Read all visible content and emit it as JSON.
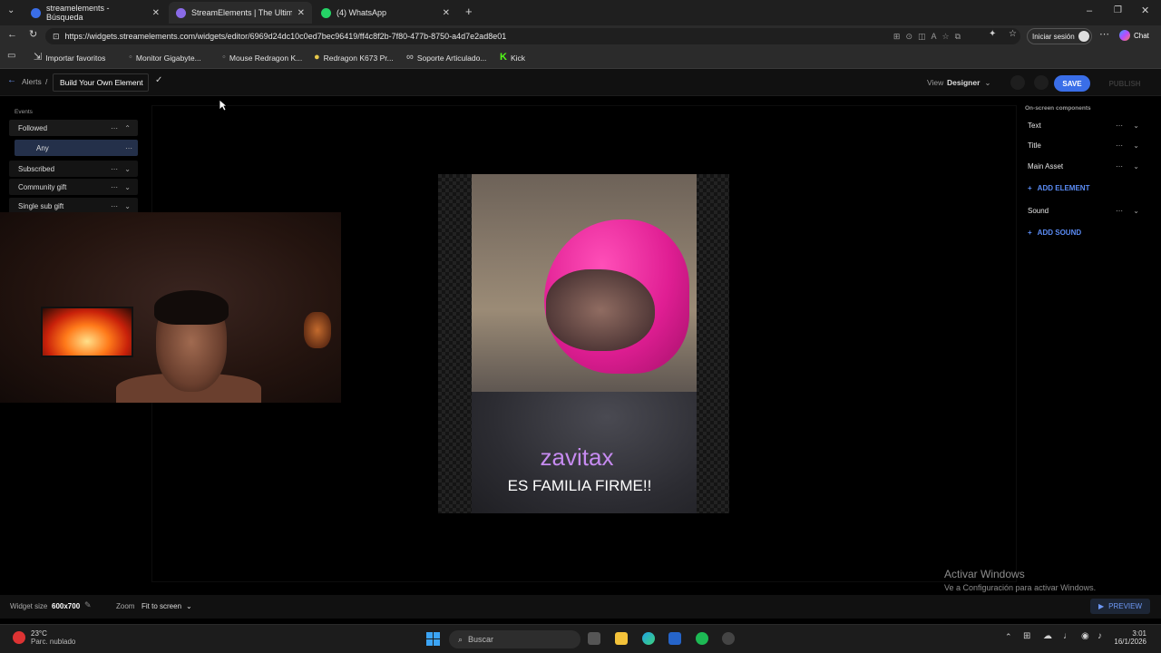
{
  "browser": {
    "tabs": [
      {
        "title": "streamelements - Búsqueda",
        "favicon_color": "#3a6ee8"
      },
      {
        "title": "StreamElements | The Ultimate St",
        "favicon_color": "#8a6be8"
      },
      {
        "title": "(4) WhatsApp",
        "favicon_color": "#25d366"
      }
    ],
    "url": "https://widgets.streamelements.com/widgets/editor/6969d24dc10c0ed7bec96419/ff4c8f2b-7f80-477b-8750-a4d7e2ad8e01",
    "signin_label": "Iniciar sesión",
    "chat_label": "Chat",
    "bookmarks": [
      "Importar favoritos",
      "Monitor Gigabyte...",
      "Mouse Redragon K...",
      "Redragon K673 Pr...",
      "Soporte Articulado...",
      "Kick"
    ]
  },
  "header": {
    "breadcrumb_root": "Alerts",
    "breadcrumb_sep": "/",
    "widget_name": "Build Your Own Element",
    "view_label": "View",
    "view_mode": "Designer",
    "save_label": "SAVE",
    "publish_label": "PUBLISH"
  },
  "events": {
    "heading": "Events",
    "items": [
      {
        "label": "Followed",
        "expanded": true
      },
      {
        "label": "Any",
        "sub": true,
        "selected": true
      },
      {
        "label": "Subscribed"
      },
      {
        "label": "Community gift"
      },
      {
        "label": "Single sub gift"
      }
    ]
  },
  "alert_preview": {
    "name": "zavitax",
    "message": "ES FAMILIA FIRME!!",
    "name_color": "#c68bf0"
  },
  "components": {
    "heading": "On-screen components",
    "items": [
      "Text",
      "Title",
      "Main Asset"
    ],
    "add_element_label": "ADD ELEMENT",
    "sound_item": "Sound",
    "add_sound_label": "ADD SOUND"
  },
  "footer": {
    "widget_size_label": "Widget size",
    "widget_size_value": "600x700",
    "zoom_label": "Zoom",
    "zoom_value": "Fit to screen",
    "preview_label": "PREVIEW"
  },
  "windows_watermark": {
    "title": "Activar Windows",
    "subtitle": "Ve a Configuración para activar Windows."
  },
  "taskbar": {
    "weather_temp": "23°C",
    "weather_desc": "Parc. nublado",
    "search_placeholder": "Buscar",
    "time": "3:01",
    "date": "16/1/2026"
  }
}
